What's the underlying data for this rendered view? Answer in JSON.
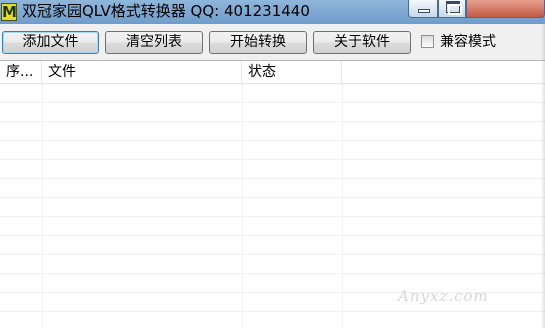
{
  "window": {
    "icon_letter": "M",
    "title": "双冠家园QLV格式转换器 QQ: 401231440"
  },
  "toolbar": {
    "add_label": "添加文件",
    "clear_label": "清空列表",
    "start_label": "开始转换",
    "about_label": "关于软件",
    "compat_label": "兼容模式",
    "compat_checked": false
  },
  "list": {
    "columns": [
      "序...",
      "文件",
      "状态"
    ],
    "rows": []
  },
  "watermark": "Anyxz.com",
  "icons": [
    "app-icon",
    "minimize-icon",
    "maximize-icon",
    "close-icon",
    "checkbox-icon"
  ]
}
